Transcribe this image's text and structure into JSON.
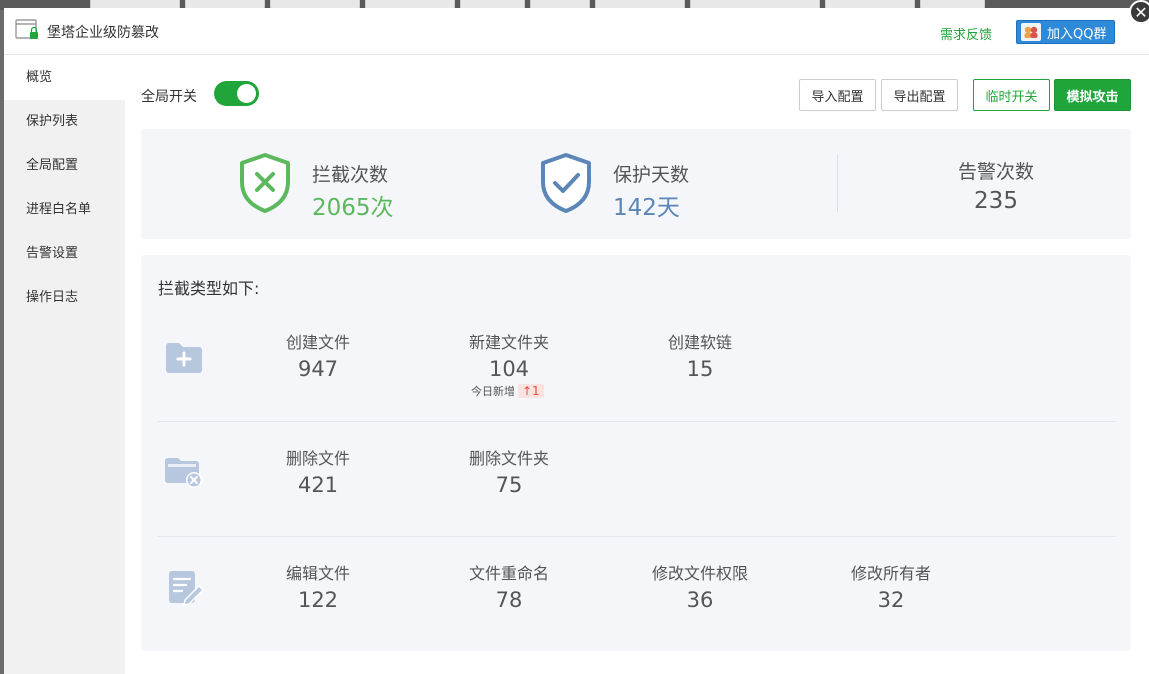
{
  "window": {
    "title": "堡塔企业级防篡改",
    "feedback_link": "需求反馈",
    "qq_button": "加入QQ群",
    "close_glyph": "✕"
  },
  "sidebar": {
    "items": [
      {
        "label": "概览",
        "active": true
      },
      {
        "label": "保护列表"
      },
      {
        "label": "全局配置"
      },
      {
        "label": "进程白名单"
      },
      {
        "label": "告警设置"
      },
      {
        "label": "操作日志"
      }
    ]
  },
  "toolbar": {
    "global_switch_label": "全局开关",
    "global_switch_on": true,
    "import_label": "导入配置",
    "export_label": "导出配置",
    "temp_switch_label": "临时开关",
    "simulate_label": "模拟攻击"
  },
  "stats": {
    "intercept": {
      "label": "拦截次数",
      "value": "2065次",
      "icon": "shield-x-icon",
      "color": "#5cb85c"
    },
    "protect_days": {
      "label": "保护天数",
      "value": "142天",
      "icon": "shield-check-icon",
      "color": "#5b86b5"
    },
    "alerts": {
      "label": "告警次数",
      "value": "235"
    }
  },
  "types": {
    "title": "拦截类型如下:",
    "rows": [
      {
        "icon": "folder-add-icon",
        "metrics": [
          {
            "label": "创建文件",
            "value": "947"
          },
          {
            "label": "新建文件夹",
            "value": "104",
            "today_label": "今日新增",
            "today_value": "↑1"
          },
          {
            "label": "创建软链",
            "value": "15"
          }
        ]
      },
      {
        "icon": "folder-delete-icon",
        "metrics": [
          {
            "label": "删除文件",
            "value": "421"
          },
          {
            "label": "删除文件夹",
            "value": "75"
          }
        ]
      },
      {
        "icon": "file-edit-icon",
        "metrics": [
          {
            "label": "编辑文件",
            "value": "122"
          },
          {
            "label": "文件重命名",
            "value": "78"
          },
          {
            "label": "修改文件权限",
            "value": "36"
          },
          {
            "label": "修改所有者",
            "value": "32"
          }
        ]
      }
    ]
  },
  "colors": {
    "accent_green": "#20a53a",
    "panel_bg": "#f4f6fa",
    "icon_blue": "#b7c7de"
  }
}
